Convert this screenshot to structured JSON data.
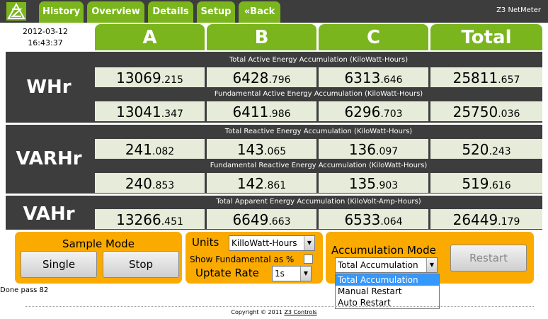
{
  "nav": {
    "history": "History",
    "overview": "Overview",
    "details": "Details",
    "setup": "Setup",
    "back": "«Back"
  },
  "app_name": "Z3 NetMeter",
  "datetime": {
    "date": "2012-03-12",
    "time": "16:43:37"
  },
  "columns": [
    "A",
    "B",
    "C",
    "Total"
  ],
  "sections": {
    "whr": {
      "label": "WHr",
      "captions": [
        "Total Active Energy Accumulation (KiloWatt-Hours)",
        "Fundamental Active Energy Accumulation (KiloWatt-Hours)"
      ],
      "rows": [
        [
          [
            "13069",
            ".215"
          ],
          [
            "6428",
            ".796"
          ],
          [
            "6313",
            ".646"
          ],
          [
            "25811",
            ".657"
          ]
        ],
        [
          [
            "13041",
            ".347"
          ],
          [
            "6411",
            ".986"
          ],
          [
            "6296",
            ".703"
          ],
          [
            "25750",
            ".036"
          ]
        ]
      ]
    },
    "varhr": {
      "label": "VARHr",
      "captions": [
        "Total Reactive Energy Accumulation (KiloWatt-Hours)",
        "Fundamental Reactive Energy Accumulation (KiloWatt-Hours)"
      ],
      "rows": [
        [
          [
            "241",
            ".082"
          ],
          [
            "143",
            ".065"
          ],
          [
            "136",
            ".097"
          ],
          [
            "520",
            ".243"
          ]
        ],
        [
          [
            "240",
            ".853"
          ],
          [
            "142",
            ".861"
          ],
          [
            "135",
            ".903"
          ],
          [
            "519",
            ".616"
          ]
        ]
      ]
    },
    "vahr": {
      "label": "VAHr",
      "captions": [
        "Total Apparent Energy Accumulation (KiloVolt-Amp-Hours)"
      ],
      "rows": [
        [
          [
            "13266",
            ".451"
          ],
          [
            "6649",
            ".663"
          ],
          [
            "6533",
            ".064"
          ],
          [
            "26449",
            ".179"
          ]
        ]
      ]
    }
  },
  "sample_mode": {
    "title": "Sample Mode",
    "single": "Single",
    "stop": "Stop"
  },
  "units": {
    "label": "Units",
    "value": "KilloWatt-Hours",
    "show_fundamental": "Show Fundamental as %",
    "update_label": "Uptate Rate",
    "update_value": "1s"
  },
  "accumulation": {
    "title": "Accumulation Mode",
    "value": "Total Accumulation",
    "restart": "Restart",
    "options": [
      "Total Accumulation",
      "Manual Restart",
      "Auto Restart"
    ]
  },
  "status": "Done pass 82",
  "footer": {
    "text": "Copyright © 2011 ",
    "link": "Z3 Controls"
  },
  "colors": {
    "accent_green": "#7ab51d",
    "panel_dark": "#3d3d3d",
    "control_orange": "#fbaa00",
    "cell_bg": "#e6ecd9"
  }
}
